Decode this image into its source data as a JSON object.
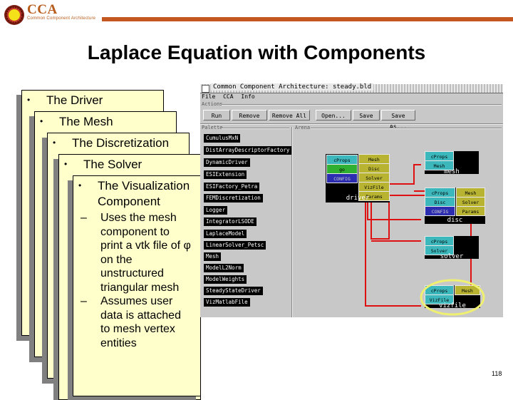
{
  "header": {
    "logo_text": "CCA",
    "logo_subtitle": "Common Component Architecture",
    "brand_color": "#c4571f"
  },
  "slide": {
    "title": "Laplace Equation with Components",
    "page_number": "118"
  },
  "cards": [
    {
      "bullet": "•",
      "label": "The Driver"
    },
    {
      "bullet": "•",
      "label": "The Mesh"
    },
    {
      "bullet": "•",
      "label": "The Discretization"
    },
    {
      "bullet": "•",
      "label": "The Solver"
    },
    {
      "bullet": "•",
      "label_line1": "The Visualization",
      "label_line2": "Component",
      "sub_bullets": [
        {
          "dash": "–",
          "lines": [
            "Uses the mesh",
            "component to",
            "print a vtk file of φ",
            "on the",
            "unstructured",
            "triangular mesh"
          ]
        },
        {
          "dash": "–",
          "lines": [
            "Assumes user",
            "data is attached",
            "to mesh vertex",
            "entities"
          ]
        }
      ]
    }
  ],
  "window": {
    "title": "Common Component Architecture: steady.bld",
    "menu": [
      "File",
      "CCA",
      "Info"
    ],
    "actions_label": "Actions",
    "buttons": [
      "Run",
      "Remove",
      "Remove All",
      "Open...",
      "Save",
      "Save As..."
    ],
    "palette_label": "Palette",
    "arena_label": "Arena",
    "palette_items": [
      "CumulusMxN",
      "DistArrayDescriptorFactory",
      "DynamicDriver",
      "ESIExtension",
      "ESIFactory_Petra",
      "FEMDiscretization",
      "Logger",
      "IntegratorLSODE",
      "LaplaceModel",
      "LinearSolver_Petsc",
      "Mesh",
      "ModelL2Norm",
      "ModelWeights",
      "SteadyStateDriver",
      "VizMatlabFile"
    ],
    "components": {
      "driver": {
        "name": "driver",
        "uses": [
          "cProps",
          "go",
          "CONFIG"
        ],
        "provides": [
          "Mesh",
          "Disc",
          "Solver",
          "VizFile",
          "Params"
        ]
      },
      "mesh": {
        "name": "mesh",
        "uses": [
          "cProps",
          "Mesh"
        ],
        "provides": []
      },
      "disc": {
        "name": "disc",
        "uses": [
          "cProps",
          "Disc",
          "CONFIG"
        ],
        "provides": [
          "Mesh",
          "Solver",
          "Params"
        ]
      },
      "solver": {
        "name": "solver",
        "uses": [
          "cProps",
          "Solver"
        ],
        "provides": []
      },
      "vizfile": {
        "name": "vizfile",
        "uses": [
          "cProps",
          "VizFile"
        ],
        "provides": [
          "Mesh"
        ]
      }
    },
    "wire_color": "#dd1111",
    "highlight_color": "#f0f070"
  }
}
